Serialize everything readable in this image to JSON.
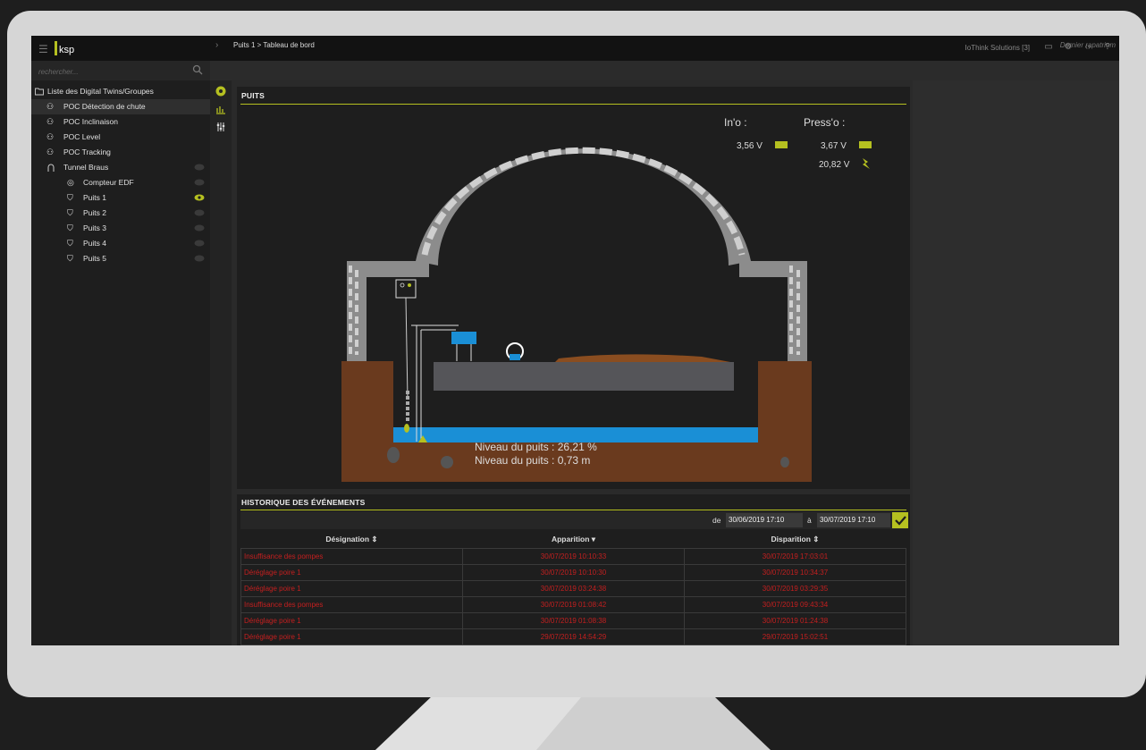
{
  "app": {
    "logo_text": "ksp",
    "organization": "IoThink Solutions [3]"
  },
  "search": {
    "placeholder": "rechercher..."
  },
  "breadcrumb": "Puits 1 > Tableau de bord",
  "last_sync": "Dernier rapatriem",
  "sidebar": {
    "root_label": "Liste des Digital Twins/Groupes",
    "items": [
      {
        "label": "POC Détection de chute",
        "selected": true
      },
      {
        "label": "POC Inclinaison"
      },
      {
        "label": "POC Level"
      },
      {
        "label": "POC Tracking"
      },
      {
        "label": "Tunnel Braus"
      },
      {
        "label": "Compteur EDF"
      },
      {
        "label": "Puits 1",
        "active": true
      },
      {
        "label": "Puits 2"
      },
      {
        "label": "Puits 3"
      },
      {
        "label": "Puits 4"
      },
      {
        "label": "Puits 5"
      }
    ]
  },
  "puits_panel": {
    "title": "PUITS",
    "inio_label": "In'o :",
    "presso_label": "Press'o :",
    "inio_voltage": "3,56 V",
    "presso_voltage": "3,67 V",
    "presso_power": "20,82 V",
    "level_percent_text": "Niveau du puits : 26,21 %",
    "level_meters_text": "Niveau du puits : 0,73 m",
    "water_level_fraction": 0.26
  },
  "history": {
    "title": "HISTORIQUE DES ÉVÉNEMENTS",
    "from_label": "de",
    "from_value": "30/06/2019 17:10",
    "to_label": "à",
    "to_value": "30/07/2019 17:10",
    "columns": [
      "Désignation ⇕",
      "Apparition ▾",
      "Disparition ⇕"
    ],
    "rows": [
      [
        "Insuffisance des pompes",
        "30/07/2019 10:10:33",
        "30/07/2019 17:03:01"
      ],
      [
        "Déréglage poire 1",
        "30/07/2019 10:10:30",
        "30/07/2019 10:34:37"
      ],
      [
        "Déréglage poire 1",
        "30/07/2019 03:24:38",
        "30/07/2019 03:29:35"
      ],
      [
        "Insuffisance des pompes",
        "30/07/2019 01:08:42",
        "30/07/2019 09:43:34"
      ],
      [
        "Déréglage poire 1",
        "30/07/2019 01:08:38",
        "30/07/2019 01:24:38"
      ],
      [
        "Déréglage poire 1",
        "29/07/2019 14:54:29",
        "29/07/2019 15:02:51"
      ]
    ]
  },
  "colors": {
    "accent": "#b5c020",
    "alarm": "#c41f1f",
    "water": "#1a8fd6",
    "earth": "#6a3a1e"
  }
}
